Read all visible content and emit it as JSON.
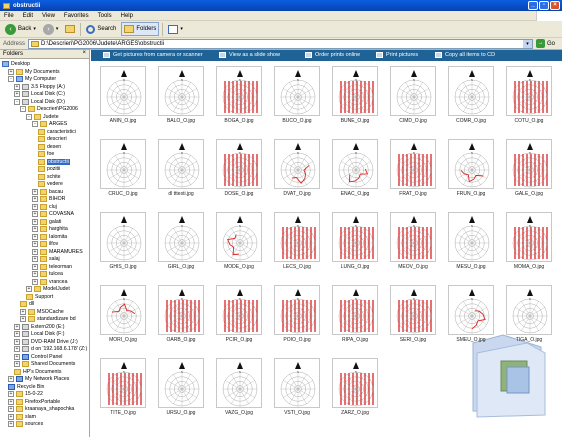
{
  "window": {
    "title": "obstructii"
  },
  "menu": [
    "File",
    "Edit",
    "View",
    "Favorites",
    "Tools",
    "Help"
  ],
  "toolbar": {
    "back": "Back",
    "search": "Search",
    "folders": "Folders"
  },
  "address": {
    "label": "Address",
    "value": "D:\\Descrieri\\PG2006\\Judete\\ARGES\\obstructii",
    "go": "Go"
  },
  "sidebar": {
    "title": "Folders",
    "tree": [
      {
        "label": "Desktop",
        "level": 0,
        "icon": "desktop-icon",
        "tog": ""
      },
      {
        "label": "My Documents",
        "level": 1,
        "icon": "folder-icon",
        "tog": "+"
      },
      {
        "label": "My Computer",
        "level": 1,
        "icon": "computer-icon",
        "tog": "-"
      },
      {
        "label": "3.5 Floppy (A:)",
        "level": 2,
        "icon": "drive-icon",
        "tog": "+"
      },
      {
        "label": "Local Disk (C:)",
        "level": 2,
        "icon": "drive-icon",
        "tog": "+"
      },
      {
        "label": "Local Disk (D:)",
        "level": 2,
        "icon": "drive-icon",
        "tog": "-"
      },
      {
        "label": "Descrieri\\PG2006",
        "level": 3,
        "icon": "folder-icon",
        "tog": "-"
      },
      {
        "label": "Judete",
        "level": 4,
        "icon": "folder-icon",
        "tog": "-"
      },
      {
        "label": "ARGES",
        "level": 5,
        "icon": "folder-icon",
        "tog": "-"
      },
      {
        "label": "caracteristici",
        "level": 6,
        "icon": "folder-icon",
        "tog": ""
      },
      {
        "label": "descrieri",
        "level": 6,
        "icon": "folder-icon",
        "tog": ""
      },
      {
        "label": "desen",
        "level": 6,
        "icon": "folder-icon",
        "tog": ""
      },
      {
        "label": "foe",
        "level": 6,
        "icon": "folder-icon",
        "tog": ""
      },
      {
        "label": "obstructii",
        "level": 6,
        "icon": "folder-icon",
        "tog": "",
        "selected": true
      },
      {
        "label": "pozitii",
        "level": 6,
        "icon": "folder-icon",
        "tog": ""
      },
      {
        "label": "schite",
        "level": 6,
        "icon": "folder-icon",
        "tog": ""
      },
      {
        "label": "vedere",
        "level": 6,
        "icon": "folder-icon",
        "tog": ""
      },
      {
        "label": "bacau",
        "level": 5,
        "icon": "folder-icon",
        "tog": "+"
      },
      {
        "label": "BIHOR",
        "level": 5,
        "icon": "folder-icon",
        "tog": "+"
      },
      {
        "label": "cluj",
        "level": 5,
        "icon": "folder-icon",
        "tog": "+"
      },
      {
        "label": "COVASNA",
        "level": 5,
        "icon": "folder-icon",
        "tog": "+"
      },
      {
        "label": "galati",
        "level": 5,
        "icon": "folder-icon",
        "tog": "+"
      },
      {
        "label": "harghita",
        "level": 5,
        "icon": "folder-icon",
        "tog": "+"
      },
      {
        "label": "Ialomita",
        "level": 5,
        "icon": "folder-icon",
        "tog": "+"
      },
      {
        "label": "ilfov",
        "level": 5,
        "icon": "folder-icon",
        "tog": "+"
      },
      {
        "label": "MARAMURES",
        "level": 5,
        "icon": "folder-icon",
        "tog": "+"
      },
      {
        "label": "salaj",
        "level": 5,
        "icon": "folder-icon",
        "tog": "+"
      },
      {
        "label": "teleorman",
        "level": 5,
        "icon": "folder-icon",
        "tog": "+"
      },
      {
        "label": "tulcea",
        "level": 5,
        "icon": "folder-icon",
        "tog": "+"
      },
      {
        "label": "vrancea",
        "level": 5,
        "icon": "folder-icon",
        "tog": "+"
      },
      {
        "label": "ModelJudet",
        "level": 4,
        "icon": "folder-icon",
        "tog": "+"
      },
      {
        "label": "Support",
        "level": 4,
        "icon": "folder-icon",
        "tog": ""
      },
      {
        "label": "dll",
        "level": 3,
        "icon": "folder-icon",
        "tog": ""
      },
      {
        "label": "MSOCache",
        "level": 3,
        "icon": "folder-icon",
        "tog": "+"
      },
      {
        "label": "standardizare bd",
        "level": 3,
        "icon": "folder-icon",
        "tog": "+"
      },
      {
        "label": "Extern200 (E:)",
        "level": 2,
        "icon": "drive-icon",
        "tog": "+"
      },
      {
        "label": "Local Disk (F:)",
        "level": 2,
        "icon": "drive-icon",
        "tog": "+"
      },
      {
        "label": "DVD-RAM Drive (J:)",
        "level": 2,
        "icon": "drive-icon",
        "tog": "+"
      },
      {
        "label": "d on '192.168.6.178' (Z:)",
        "level": 2,
        "icon": "drive-icon",
        "tog": "+"
      },
      {
        "label": "Control Panel",
        "level": 2,
        "icon": "special-icon",
        "tog": "+"
      },
      {
        "label": "Shared Documents",
        "level": 2,
        "icon": "folder-icon",
        "tog": "+"
      },
      {
        "label": "HP's Documents",
        "level": 2,
        "icon": "folder-icon",
        "tog": ""
      },
      {
        "label": "My Network Places",
        "level": 1,
        "icon": "special-icon",
        "tog": "+"
      },
      {
        "label": "Recycle Bin",
        "level": 1,
        "icon": "special-icon",
        "tog": ""
      },
      {
        "label": "15-0-22",
        "level": 1,
        "icon": "folder-icon",
        "tog": "+"
      },
      {
        "label": "FirefoxPortable",
        "level": 1,
        "icon": "folder-icon",
        "tog": "+"
      },
      {
        "label": "kraanaya_shapochka",
        "level": 1,
        "icon": "folder-icon",
        "tog": "+"
      },
      {
        "label": "slam",
        "level": 1,
        "icon": "folder-icon",
        "tog": "+"
      },
      {
        "label": "sources",
        "level": 1,
        "icon": "folder-icon",
        "tog": "+"
      }
    ]
  },
  "tasks": [
    "Get pictures from camera or scanner",
    "View as a slide show",
    "Order prints online",
    "Print pictures",
    "Copy all items to CD"
  ],
  "files": [
    {
      "name": "ANIN_O.jpg",
      "style": "plain"
    },
    {
      "name": "BALO_O.jpg",
      "style": "plain"
    },
    {
      "name": "BOGA_O.jpg",
      "style": "red"
    },
    {
      "name": "BUCO_O.jpg",
      "style": "plain"
    },
    {
      "name": "BUNE_O.jpg",
      "style": "red"
    },
    {
      "name": "CIMD_O.jpg",
      "style": "plain"
    },
    {
      "name": "COMR_O.jpg",
      "style": "plain"
    },
    {
      "name": "COTU_O.jpg",
      "style": "red"
    },
    {
      "name": "CRUC_O.jpg",
      "style": "plain"
    },
    {
      "name": "dl tttesti.jpg",
      "style": "plain"
    },
    {
      "name": "DOSE_O.jpg",
      "style": "red"
    },
    {
      "name": "DVAT_O.jpg",
      "style": "partial"
    },
    {
      "name": "ENAC_O.jpg",
      "style": "partial"
    },
    {
      "name": "FRAT_O.jpg",
      "style": "red"
    },
    {
      "name": "FRUN_O.jpg",
      "style": "partial"
    },
    {
      "name": "GALE_O.jpg",
      "style": "red"
    },
    {
      "name": "GHIS_O.jpg",
      "style": "plain"
    },
    {
      "name": "GIRL_O.jpg",
      "style": "plain"
    },
    {
      "name": "MODE_O.jpg",
      "style": "partial"
    },
    {
      "name": "LECS_O.jpg",
      "style": "red"
    },
    {
      "name": "LUNG_O.jpg",
      "style": "red"
    },
    {
      "name": "MEOV_O.jpg",
      "style": "red"
    },
    {
      "name": "MESU_O.jpg",
      "style": "plain"
    },
    {
      "name": "MOMA_O.jpg",
      "style": "red"
    },
    {
      "name": "MORI_O.jpg",
      "style": "partial"
    },
    {
      "name": "OARB_O.jpg",
      "style": "red"
    },
    {
      "name": "PCIR_O.jpg",
      "style": "red"
    },
    {
      "name": "POIO_O.jpg",
      "style": "red"
    },
    {
      "name": "RIPA_O.jpg",
      "style": "red"
    },
    {
      "name": "SERI_O.jpg",
      "style": "red"
    },
    {
      "name": "SMEU_O.jpg",
      "style": "partial"
    },
    {
      "name": "TIGA_O.jpg",
      "style": "plain"
    },
    {
      "name": "TITE_O.jpg",
      "style": "red"
    },
    {
      "name": "URSU_O.jpg",
      "style": "plain"
    },
    {
      "name": "VAZG_O.jpg",
      "style": "plain"
    },
    {
      "name": "VSTI_O.jpg",
      "style": "plain"
    },
    {
      "name": "ZARZ_O.jpg",
      "style": "red"
    }
  ]
}
